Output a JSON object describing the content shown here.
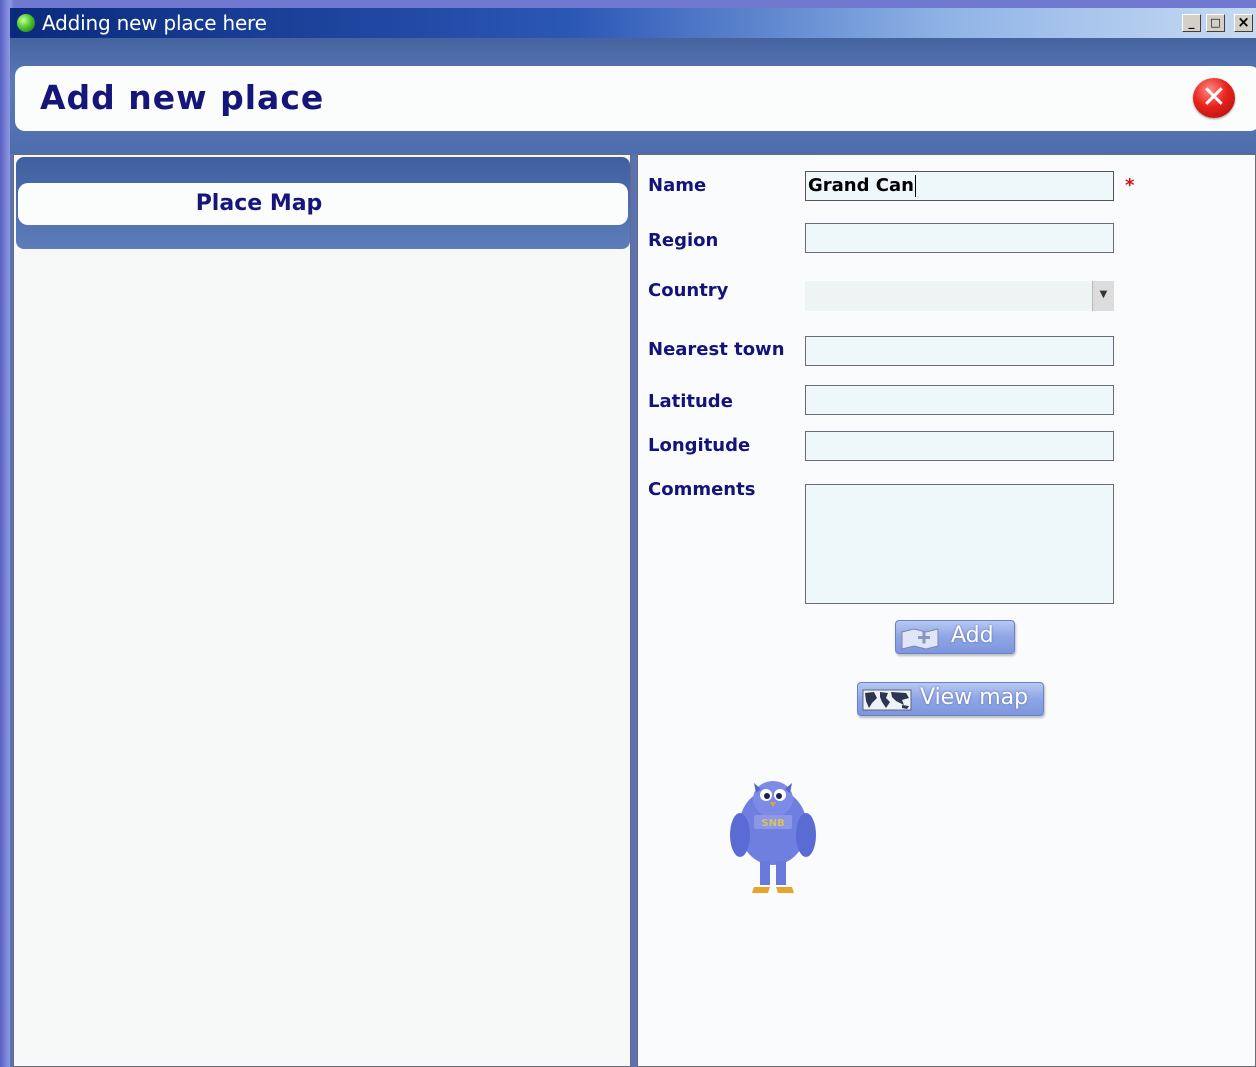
{
  "window": {
    "title": "Adding new place here",
    "controls": {
      "minimize": "_",
      "maximize": "□",
      "close": "×"
    }
  },
  "header": {
    "title": "Add new place",
    "close_icon": "close-circle-icon"
  },
  "left_panel": {
    "tab_label": "Place Map"
  },
  "form": {
    "fields": {
      "name": {
        "label": "Name",
        "value": "Grand Can",
        "required_marker": "*"
      },
      "region": {
        "label": "Region",
        "value": ""
      },
      "country": {
        "label": "Country",
        "value": ""
      },
      "nearest_town": {
        "label": "Nearest town",
        "value": ""
      },
      "latitude": {
        "label": "Latitude",
        "value": ""
      },
      "longitude": {
        "label": "Longitude",
        "value": ""
      },
      "comments": {
        "label": "Comments",
        "value": ""
      }
    },
    "buttons": {
      "add": {
        "label": "Add",
        "icon": "add-place-icon"
      },
      "view_map": {
        "label": "View map",
        "icon": "world-map-icon"
      }
    }
  },
  "mascot": {
    "icon": "owl-mascot-icon"
  },
  "colors": {
    "label": "#14137a",
    "required": "#d21010",
    "field_bg": "#eef7f9",
    "accent": "#5a72b3"
  }
}
